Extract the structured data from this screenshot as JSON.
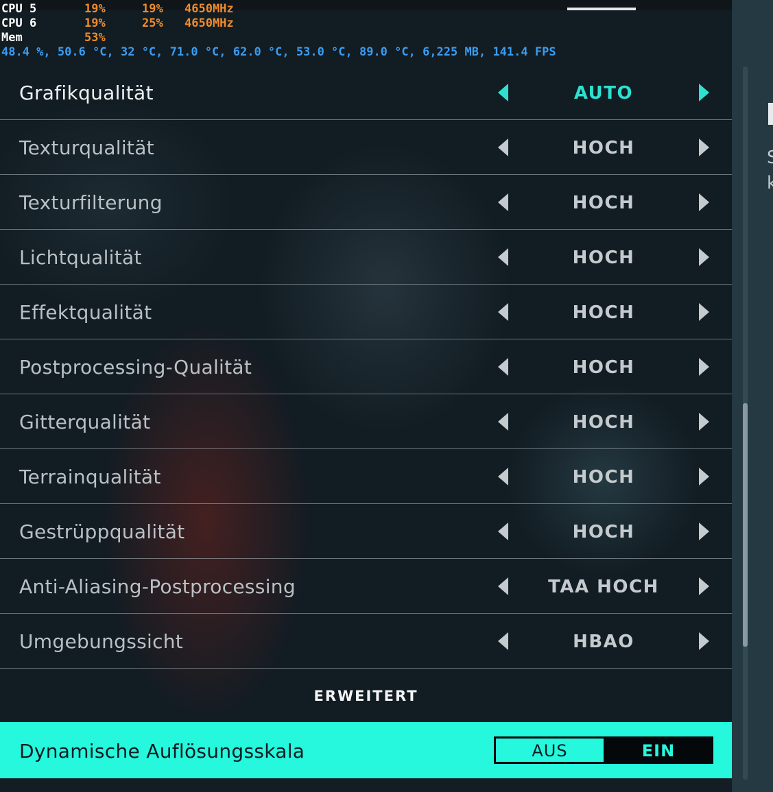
{
  "hud": {
    "rows": [
      {
        "label": "CPU 5",
        "v1": "19%",
        "v2": "19%",
        "v3": "4650MHz"
      },
      {
        "label": "CPU 6",
        "v1": "19%",
        "v2": "25%",
        "v3": "4650MHz"
      },
      {
        "label": "Mem",
        "v1": "53%",
        "v2": "",
        "v3": ""
      }
    ],
    "info": "48.4 %, 50.6 °C, 32 °C, 71.0 °C, 62.0 °C, 53.0 °C, 89.0 °C, 6,225 MB, 141.4 FPS"
  },
  "settings": [
    {
      "label": "Grafikqualität",
      "value": "AUTO",
      "active": true
    },
    {
      "label": "Texturqualität",
      "value": "HOCH"
    },
    {
      "label": "Texturfilterung",
      "value": "HOCH"
    },
    {
      "label": "Lichtqualität",
      "value": "HOCH"
    },
    {
      "label": "Effektqualität",
      "value": "HOCH"
    },
    {
      "label": "Postprocessing-Qualität",
      "value": "HOCH"
    },
    {
      "label": "Gitterqualität",
      "value": "HOCH"
    },
    {
      "label": "Terrainqualität",
      "value": "HOCH"
    },
    {
      "label": "Gestrüppqualität",
      "value": "HOCH"
    },
    {
      "label": "Anti-Aliasing-Postprocessing",
      "value": "TAA HOCH"
    },
    {
      "label": "Umgebungssicht",
      "value": "HBAO"
    }
  ],
  "advanced_label": "ERWEITERT",
  "toggle_setting": {
    "label": "Dynamische Auflösungsskala",
    "off_label": "AUS",
    "on_label": "EIN",
    "selected": "EIN"
  },
  "side_panel": {
    "text_1": "S",
    "text_2": "k"
  },
  "colors": {
    "accent": "#25f8dd",
    "hud_orange": "#f08c2c",
    "hud_blue": "#3a9cf0",
    "background": "#121c23"
  },
  "icons": {
    "prev": "caret-left-icon",
    "next": "caret-right-icon"
  }
}
